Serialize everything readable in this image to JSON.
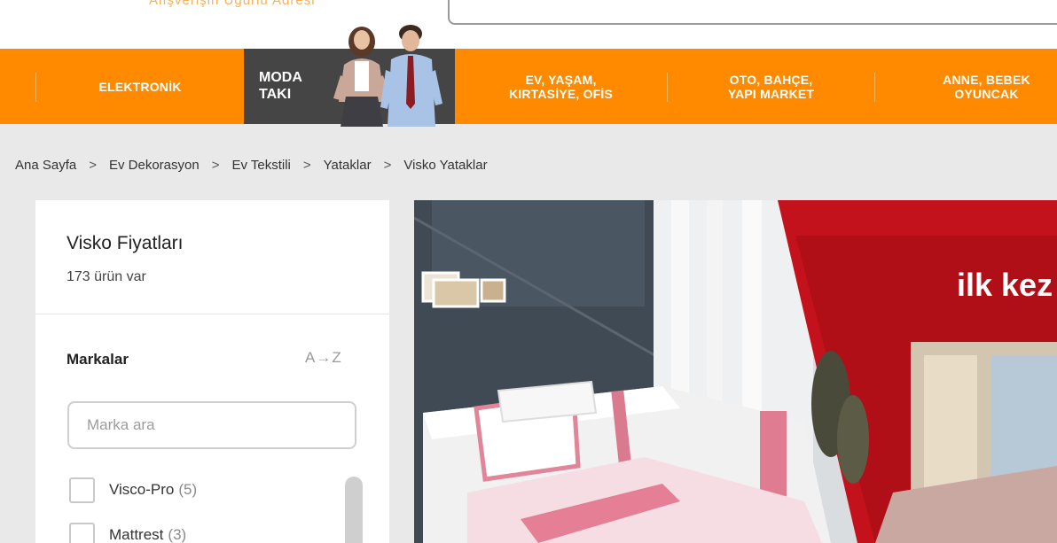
{
  "header": {
    "tagline": "Alışverişin Uğurlu Adresi"
  },
  "categories": [
    {
      "label": "ELEKTRONİK"
    },
    {
      "label": "MODA\nTAKI"
    },
    {
      "label": "EV, YAŞAM,\nKIRTASİYE, OFİS"
    },
    {
      "label": "OTO, BAHÇE,\nYAPI MARKET"
    },
    {
      "label": "ANNE, BEBEK\nOYUNCAK"
    }
  ],
  "breadcrumb": {
    "items": [
      "Ana Sayfa",
      "Ev Dekorasyon",
      "Ev Tekstili",
      "Yataklar",
      "Visko Yataklar"
    ],
    "separator": ">"
  },
  "sidebar": {
    "title": "Visko Fiyatları",
    "count": "173 ürün var",
    "brands_heading": "Markalar",
    "sort_label": "A→Z",
    "search_placeholder": "Marka ara",
    "brands": [
      {
        "name": "Visco-Pro",
        "count": "(5)"
      },
      {
        "name": "Mattrest",
        "count": "(3)"
      }
    ]
  },
  "banner": {
    "headline": "ilk kez"
  },
  "colors": {
    "brand_orange": "#ff8a00",
    "moda_dark": "#454545",
    "banner_red": "#c4121c"
  }
}
